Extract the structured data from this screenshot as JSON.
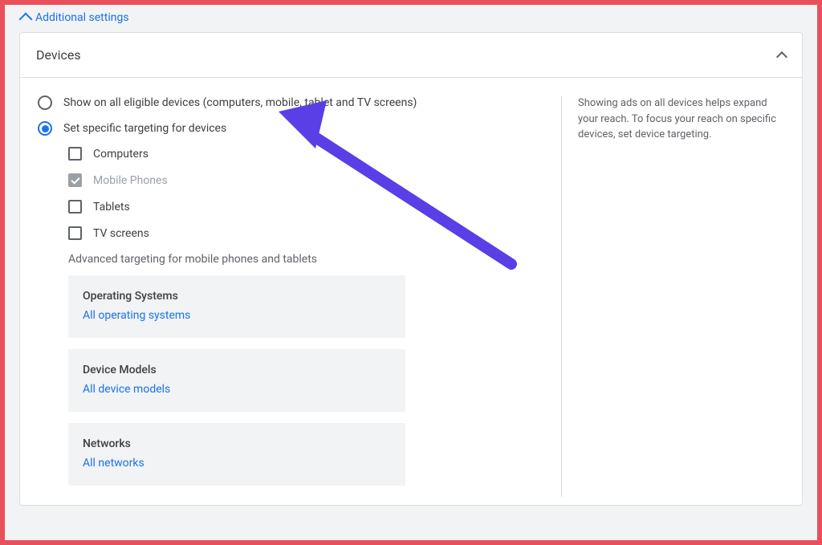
{
  "top_link": {
    "label": "Additional settings"
  },
  "card": {
    "title": "Devices",
    "help_text": "Showing ads on all devices helps expand your reach. To focus your reach on specific devices, set device targeting."
  },
  "radios": {
    "all_devices": "Show on all eligible devices (computers, mobile, tablet and TV screens)",
    "specific": "Set specific targeting for devices"
  },
  "device_checkboxes": [
    {
      "label": "Computers",
      "checked": false,
      "locked": false
    },
    {
      "label": "Mobile Phones",
      "checked": true,
      "locked": true
    },
    {
      "label": "Tablets",
      "checked": false,
      "locked": false
    },
    {
      "label": "TV screens",
      "checked": false,
      "locked": false
    }
  ],
  "advanced_label": "Advanced targeting for mobile phones and tablets",
  "advanced_sections": {
    "os": {
      "title": "Operating Systems",
      "link": "All operating systems"
    },
    "models": {
      "title": "Device Models",
      "link": "All device models"
    },
    "networks": {
      "title": "Networks",
      "link": "All networks"
    }
  }
}
